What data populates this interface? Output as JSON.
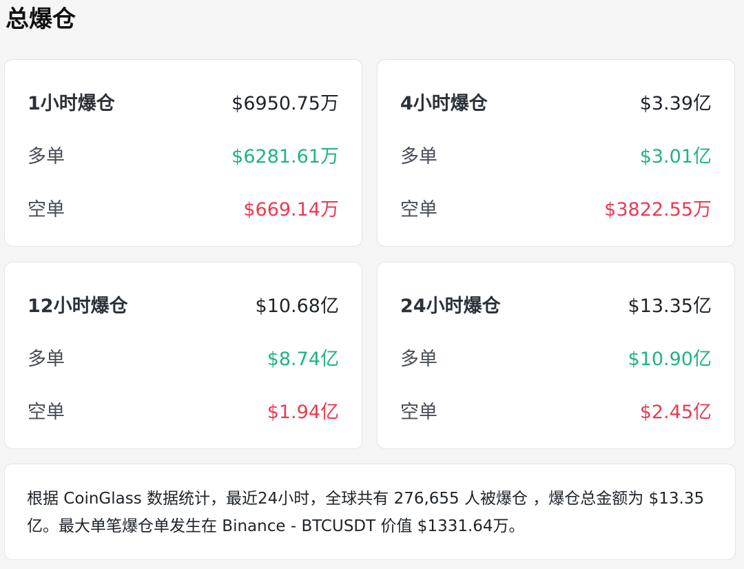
{
  "page": {
    "title": "总爆仓"
  },
  "colors": {
    "long": "#1fb37f",
    "short": "#ec3950",
    "text": "#1e2329",
    "card_border": "#e4e4e4",
    "background": "#f5f5f5"
  },
  "cards": [
    {
      "period_label": "1小时爆仓",
      "total": "$6950.75万",
      "long_label": "多单",
      "long_value": "$6281.61万",
      "short_label": "空单",
      "short_value": "$669.14万"
    },
    {
      "period_label": "4小时爆仓",
      "total": "$3.39亿",
      "long_label": "多单",
      "long_value": "$3.01亿",
      "short_label": "空单",
      "short_value": "$3822.55万"
    },
    {
      "period_label": "12小时爆仓",
      "total": "$10.68亿",
      "long_label": "多单",
      "long_value": "$8.74亿",
      "short_label": "空单",
      "short_value": "$1.94亿"
    },
    {
      "period_label": "24小时爆仓",
      "total": "$13.35亿",
      "long_label": "多单",
      "long_value": "$10.90亿",
      "short_label": "空单",
      "short_value": "$2.45亿"
    }
  ],
  "summary": {
    "text": "根据 CoinGlass 数据统计，最近24小时，全球共有 276,655 人被爆仓 ，爆仓总金额为 $13.35 亿。最大单笔爆仓单发生在 Binance - BTCUSDT 价值 $1331.64万。"
  }
}
